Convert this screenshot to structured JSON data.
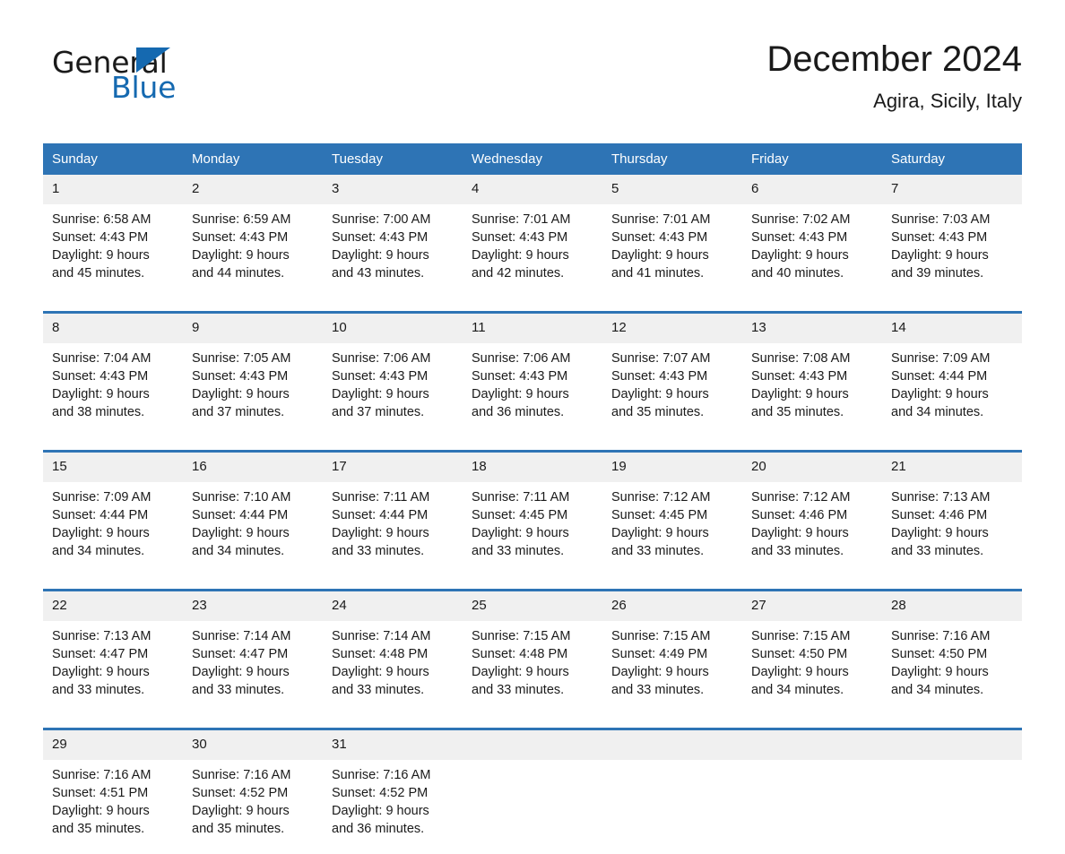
{
  "brand": {
    "name_part1": "General",
    "name_part2": "Blue",
    "accent_color": "#1569B0"
  },
  "header": {
    "month_title": "December 2024",
    "location": "Agira, Sicily, Italy"
  },
  "theme": {
    "header_blue": "#2E74B5",
    "daynum_band": "#f0f0f0"
  },
  "weekdays": [
    "Sunday",
    "Monday",
    "Tuesday",
    "Wednesday",
    "Thursday",
    "Friday",
    "Saturday"
  ],
  "weeks": [
    {
      "days": [
        {
          "num": "1",
          "sunrise": "Sunrise: 6:58 AM",
          "sunset": "Sunset: 4:43 PM",
          "daylight1": "Daylight: 9 hours",
          "daylight2": "and 45 minutes."
        },
        {
          "num": "2",
          "sunrise": "Sunrise: 6:59 AM",
          "sunset": "Sunset: 4:43 PM",
          "daylight1": "Daylight: 9 hours",
          "daylight2": "and 44 minutes."
        },
        {
          "num": "3",
          "sunrise": "Sunrise: 7:00 AM",
          "sunset": "Sunset: 4:43 PM",
          "daylight1": "Daylight: 9 hours",
          "daylight2": "and 43 minutes."
        },
        {
          "num": "4",
          "sunrise": "Sunrise: 7:01 AM",
          "sunset": "Sunset: 4:43 PM",
          "daylight1": "Daylight: 9 hours",
          "daylight2": "and 42 minutes."
        },
        {
          "num": "5",
          "sunrise": "Sunrise: 7:01 AM",
          "sunset": "Sunset: 4:43 PM",
          "daylight1": "Daylight: 9 hours",
          "daylight2": "and 41 minutes."
        },
        {
          "num": "6",
          "sunrise": "Sunrise: 7:02 AM",
          "sunset": "Sunset: 4:43 PM",
          "daylight1": "Daylight: 9 hours",
          "daylight2": "and 40 minutes."
        },
        {
          "num": "7",
          "sunrise": "Sunrise: 7:03 AM",
          "sunset": "Sunset: 4:43 PM",
          "daylight1": "Daylight: 9 hours",
          "daylight2": "and 39 minutes."
        }
      ]
    },
    {
      "days": [
        {
          "num": "8",
          "sunrise": "Sunrise: 7:04 AM",
          "sunset": "Sunset: 4:43 PM",
          "daylight1": "Daylight: 9 hours",
          "daylight2": "and 38 minutes."
        },
        {
          "num": "9",
          "sunrise": "Sunrise: 7:05 AM",
          "sunset": "Sunset: 4:43 PM",
          "daylight1": "Daylight: 9 hours",
          "daylight2": "and 37 minutes."
        },
        {
          "num": "10",
          "sunrise": "Sunrise: 7:06 AM",
          "sunset": "Sunset: 4:43 PM",
          "daylight1": "Daylight: 9 hours",
          "daylight2": "and 37 minutes."
        },
        {
          "num": "11",
          "sunrise": "Sunrise: 7:06 AM",
          "sunset": "Sunset: 4:43 PM",
          "daylight1": "Daylight: 9 hours",
          "daylight2": "and 36 minutes."
        },
        {
          "num": "12",
          "sunrise": "Sunrise: 7:07 AM",
          "sunset": "Sunset: 4:43 PM",
          "daylight1": "Daylight: 9 hours",
          "daylight2": "and 35 minutes."
        },
        {
          "num": "13",
          "sunrise": "Sunrise: 7:08 AM",
          "sunset": "Sunset: 4:43 PM",
          "daylight1": "Daylight: 9 hours",
          "daylight2": "and 35 minutes."
        },
        {
          "num": "14",
          "sunrise": "Sunrise: 7:09 AM",
          "sunset": "Sunset: 4:44 PM",
          "daylight1": "Daylight: 9 hours",
          "daylight2": "and 34 minutes."
        }
      ]
    },
    {
      "days": [
        {
          "num": "15",
          "sunrise": "Sunrise: 7:09 AM",
          "sunset": "Sunset: 4:44 PM",
          "daylight1": "Daylight: 9 hours",
          "daylight2": "and 34 minutes."
        },
        {
          "num": "16",
          "sunrise": "Sunrise: 7:10 AM",
          "sunset": "Sunset: 4:44 PM",
          "daylight1": "Daylight: 9 hours",
          "daylight2": "and 34 minutes."
        },
        {
          "num": "17",
          "sunrise": "Sunrise: 7:11 AM",
          "sunset": "Sunset: 4:44 PM",
          "daylight1": "Daylight: 9 hours",
          "daylight2": "and 33 minutes."
        },
        {
          "num": "18",
          "sunrise": "Sunrise: 7:11 AM",
          "sunset": "Sunset: 4:45 PM",
          "daylight1": "Daylight: 9 hours",
          "daylight2": "and 33 minutes."
        },
        {
          "num": "19",
          "sunrise": "Sunrise: 7:12 AM",
          "sunset": "Sunset: 4:45 PM",
          "daylight1": "Daylight: 9 hours",
          "daylight2": "and 33 minutes."
        },
        {
          "num": "20",
          "sunrise": "Sunrise: 7:12 AM",
          "sunset": "Sunset: 4:46 PM",
          "daylight1": "Daylight: 9 hours",
          "daylight2": "and 33 minutes."
        },
        {
          "num": "21",
          "sunrise": "Sunrise: 7:13 AM",
          "sunset": "Sunset: 4:46 PM",
          "daylight1": "Daylight: 9 hours",
          "daylight2": "and 33 minutes."
        }
      ]
    },
    {
      "days": [
        {
          "num": "22",
          "sunrise": "Sunrise: 7:13 AM",
          "sunset": "Sunset: 4:47 PM",
          "daylight1": "Daylight: 9 hours",
          "daylight2": "and 33 minutes."
        },
        {
          "num": "23",
          "sunrise": "Sunrise: 7:14 AM",
          "sunset": "Sunset: 4:47 PM",
          "daylight1": "Daylight: 9 hours",
          "daylight2": "and 33 minutes."
        },
        {
          "num": "24",
          "sunrise": "Sunrise: 7:14 AM",
          "sunset": "Sunset: 4:48 PM",
          "daylight1": "Daylight: 9 hours",
          "daylight2": "and 33 minutes."
        },
        {
          "num": "25",
          "sunrise": "Sunrise: 7:15 AM",
          "sunset": "Sunset: 4:48 PM",
          "daylight1": "Daylight: 9 hours",
          "daylight2": "and 33 minutes."
        },
        {
          "num": "26",
          "sunrise": "Sunrise: 7:15 AM",
          "sunset": "Sunset: 4:49 PM",
          "daylight1": "Daylight: 9 hours",
          "daylight2": "and 33 minutes."
        },
        {
          "num": "27",
          "sunrise": "Sunrise: 7:15 AM",
          "sunset": "Sunset: 4:50 PM",
          "daylight1": "Daylight: 9 hours",
          "daylight2": "and 34 minutes."
        },
        {
          "num": "28",
          "sunrise": "Sunrise: 7:16 AM",
          "sunset": "Sunset: 4:50 PM",
          "daylight1": "Daylight: 9 hours",
          "daylight2": "and 34 minutes."
        }
      ]
    },
    {
      "days": [
        {
          "num": "29",
          "sunrise": "Sunrise: 7:16 AM",
          "sunset": "Sunset: 4:51 PM",
          "daylight1": "Daylight: 9 hours",
          "daylight2": "and 35 minutes."
        },
        {
          "num": "30",
          "sunrise": "Sunrise: 7:16 AM",
          "sunset": "Sunset: 4:52 PM",
          "daylight1": "Daylight: 9 hours",
          "daylight2": "and 35 minutes."
        },
        {
          "num": "31",
          "sunrise": "Sunrise: 7:16 AM",
          "sunset": "Sunset: 4:52 PM",
          "daylight1": "Daylight: 9 hours",
          "daylight2": "and 36 minutes."
        },
        {
          "num": "",
          "sunrise": "",
          "sunset": "",
          "daylight1": "",
          "daylight2": ""
        },
        {
          "num": "",
          "sunrise": "",
          "sunset": "",
          "daylight1": "",
          "daylight2": ""
        },
        {
          "num": "",
          "sunrise": "",
          "sunset": "",
          "daylight1": "",
          "daylight2": ""
        },
        {
          "num": "",
          "sunrise": "",
          "sunset": "",
          "daylight1": "",
          "daylight2": ""
        }
      ]
    }
  ]
}
